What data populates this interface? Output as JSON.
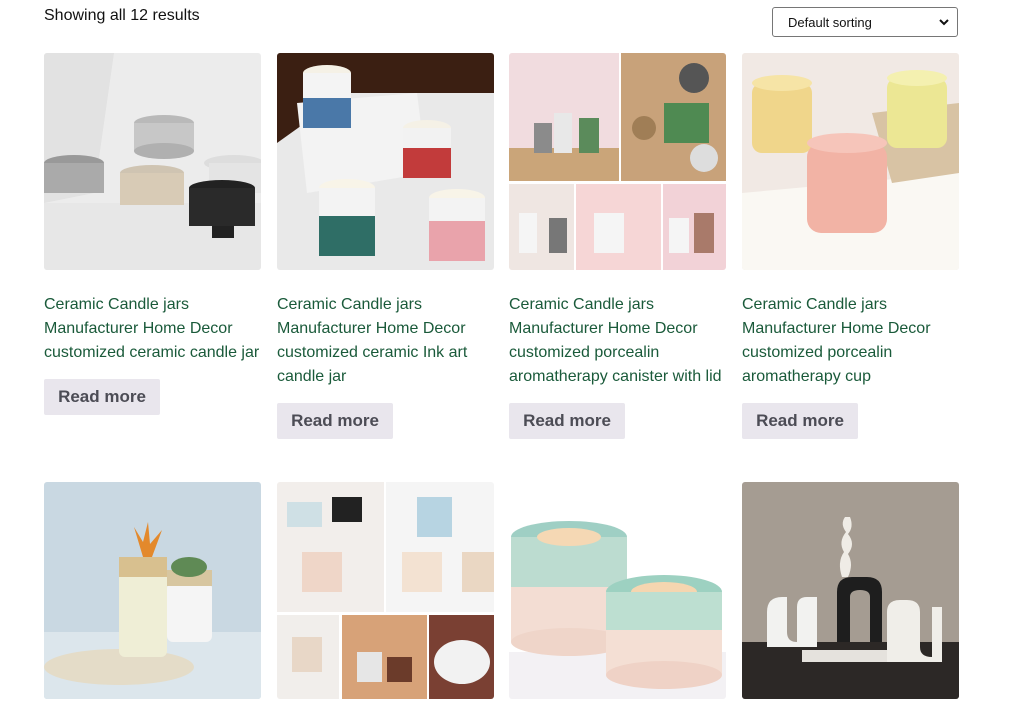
{
  "toolbar": {
    "result_count": "Showing all 12 results",
    "sort_selected": "Default sorting"
  },
  "products": [
    {
      "title": "Ceramic Candle jars\nManufacturer Home Decor\ncustomized ceramic candle jar",
      "button": "Read more",
      "image": "grey-white-black-ceramic-bowls"
    },
    {
      "title": "Ceramic Candle jars\nManufacturer Home Decor\ncustomized ceramic Ink art\ncandle jar",
      "button": "Read more",
      "image": "ink-art-candle-jars"
    },
    {
      "title": "Ceramic Candle jars\nManufacturer Home Decor\ncustomized porcealin\naromatherapy canister with lid",
      "button": "Read more",
      "image": "canister-collage"
    },
    {
      "title": "Ceramic Candle jars\nManufacturer Home Decor\ncustomized porcealin\naromatherapy cup",
      "button": "Read more",
      "image": "wavy-cups"
    },
    {
      "image": "succulent-pots"
    },
    {
      "image": "scented-candle-collage"
    },
    {
      "image": "green-glaze-jars"
    },
    {
      "image": "wavy-sculptures"
    }
  ],
  "colors": {
    "title_link": "#1a5a3a",
    "button_bg": "#e9e6ed",
    "button_text": "#4c4c55"
  }
}
